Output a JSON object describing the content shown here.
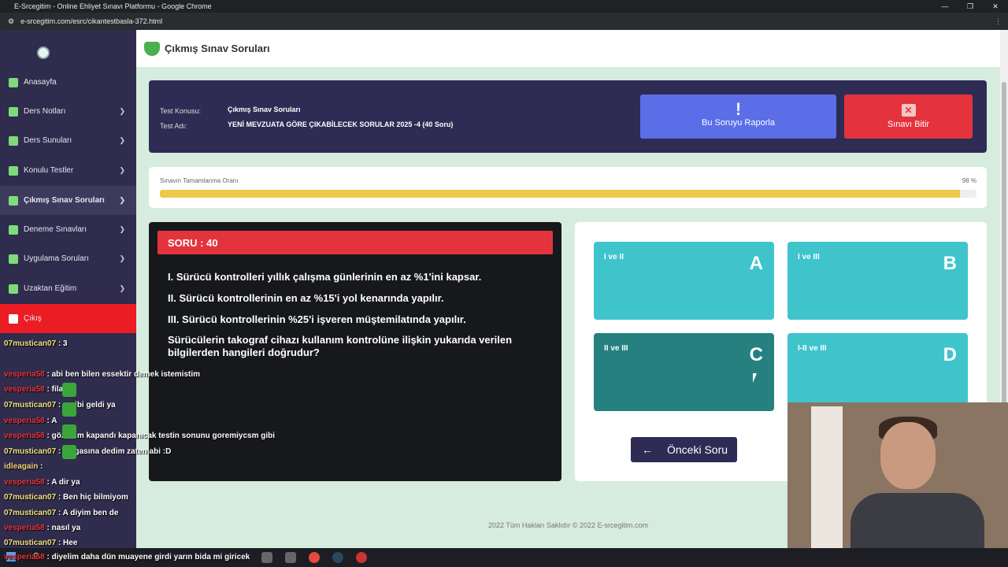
{
  "browser": {
    "window_title": "E-Srcegitim - Online Ehliyet Sınavı Platformu - Google Chrome",
    "url": "e-srcegitim.com/esrc/cikantestbasla-372.html"
  },
  "sidebar": {
    "items": [
      {
        "label": "Anasayfa"
      },
      {
        "label": "Ders Notları"
      },
      {
        "label": "Ders Sunuları"
      },
      {
        "label": "Konulu Testler"
      },
      {
        "label": "Çıkmış Sınav Soruları"
      },
      {
        "label": "Deneme Sınavları"
      },
      {
        "label": "Uygulama Soruları"
      },
      {
        "label": "Uzaktan Eğitim"
      },
      {
        "label": "Çıkış"
      }
    ]
  },
  "header": {
    "title": "Çıkmış Sınav Soruları"
  },
  "info": {
    "konu_label": "Test Konusu:",
    "konu_value": "Çıkmış Sınav Soruları",
    "adi_label": "Test Adı:",
    "adi_value": "YENİ MEVZUATA GÖRE ÇIKABİLECEK SORULAR 2025 -4 (40 Soru)",
    "report_label": "Bu Soruyu Raporla",
    "finish_label": "Sınavı Bitir"
  },
  "progress": {
    "label": "Sınavın Tamamlanma Oranı",
    "percent_text": "98 %",
    "value": 98
  },
  "question": {
    "header": "SORU : 40",
    "lines": [
      "I. Sürücü kontrolleri yıllık çalışma günlerinin en az %1'ini kapsar.",
      "II. Sürücü kontrollerinin en az %15'i yol kenarında yapılır.",
      "III. Sürücü kontrollerinin %25'i işveren müştemilatında yapılır."
    ],
    "prompt": "Sürücülerin takograf cihazı kullanım kontrolüne ilişkin yukarıda verilen bilgilerden hangileri",
    "prompt_bold": "doğrudur?"
  },
  "options": [
    {
      "text": "I ve II",
      "letter": "A"
    },
    {
      "text": "I ve III",
      "letter": "B"
    },
    {
      "text": "II ve III",
      "letter": "C"
    },
    {
      "text": "I-II ve III",
      "letter": "D"
    }
  ],
  "prev_button": {
    "label": "Önceki Soru"
  },
  "footer": {
    "text": "2022 Tüm Hakları Saklıdır © 2022 E-srcegitim.com"
  },
  "chat": [
    {
      "user": "07mustican07",
      "text": ": 3"
    },
    {
      "user": "vesperia58",
      "text": ": abi ben bilen essektir demek istemistim"
    },
    {
      "user": "vesperia58",
      "text": ": filan"
    },
    {
      "user": "07mustican07",
      "text": ": o gibi geldi ya"
    },
    {
      "user": "vesperia58",
      "text": ": A"
    },
    {
      "user": "vesperia58",
      "text": ": gözlerim kapandı kapanıcak testin sonunu goremiycsm gibi"
    },
    {
      "user": "07mustican07",
      "text": ": palgasına dedim zaten abi :D"
    },
    {
      "user": "idleagain",
      "text": ":"
    },
    {
      "user": "vesperia58",
      "text": ": A dir ya"
    },
    {
      "user": "07mustican07",
      "text": ": Ben hiç bilmiyom"
    },
    {
      "user": "07mustican07",
      "text": ": A diyim ben de"
    },
    {
      "user": "vesperia58",
      "text": ": nasıl ya"
    },
    {
      "user": "07mustican07",
      "text": ": Hee"
    },
    {
      "user": "vesperia58",
      "text": ": diyelim daha dün muayene girdi yarın bida mi giricek"
    }
  ]
}
